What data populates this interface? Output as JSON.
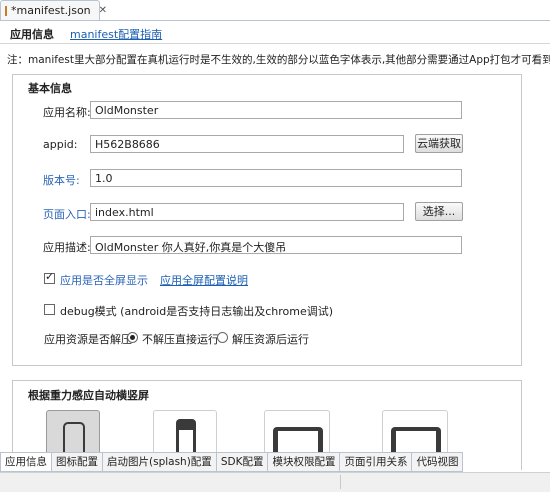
{
  "editor_tab": {
    "title": "*manifest.json",
    "close": "✕"
  },
  "header": {
    "app_info": "应用信息",
    "guide_link": "manifest配置指南"
  },
  "note": "注：manifest里大部分配置在真机运行时是不生效的,生效的部分以蓝色字体表示,其他部分需要通过App打包才可看到效果",
  "basic": {
    "title": "基本信息",
    "app_name_label": "应用名称:",
    "app_name_value": "OldMonster",
    "appid_label": "appid:",
    "appid_value": "H562B8686",
    "cloud_button": "云端获取",
    "version_label": "版本号:",
    "version_value": "1.0",
    "entry_label": "页面入口:",
    "entry_value": "index.html",
    "choose_button": "选择...",
    "desc_label": "应用描述:",
    "desc_value": "OldMonster 你人真好,你真是个大傻吊",
    "fullscreen_label": "应用是否全屏显示",
    "fullscreen_link": "应用全屏配置说明",
    "debug_label": "debug模式 (android是否支持日志输出及chrome调试)",
    "decompress_label": "应用资源是否解压",
    "radio_no": "不解压直接运行",
    "radio_yes": "解压资源后运行"
  },
  "orientation": {
    "title": "根据重力感应自动横竖屏"
  },
  "bottom_tabs": [
    "应用信息",
    "图标配置",
    "启动图片(splash)配置",
    "SDK配置",
    "模块权限配置",
    "页面引用关系",
    "代码视图"
  ],
  "colors": {
    "link": "#1a5fb4",
    "effective_label": "#2a64b8"
  }
}
